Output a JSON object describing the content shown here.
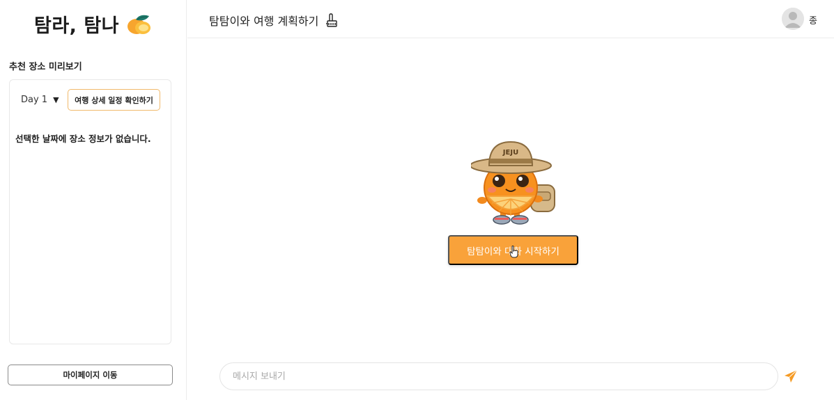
{
  "sidebar": {
    "logo_text": "탐라, 탐나",
    "section_title": "추천 장소 미리보기",
    "day_select": {
      "value": "Day 1"
    },
    "detail_button_label": "여행 상세 일정 확인하기",
    "empty_message": "선택한 날짜에 장소 정보가 없습니다.",
    "mypage_button_label": "마이페이지 이동"
  },
  "header": {
    "title": "탐탐이와 여행 계획하기",
    "user_name": "종"
  },
  "main": {
    "mascot_hat_text": "JEJU",
    "start_button_label": "탐탐이와 대화 시작하기",
    "message_input": {
      "placeholder": "메시지 보내기",
      "value": ""
    }
  },
  "colors": {
    "accent": "#f9a23a",
    "detail_button_border": "#f1b96a",
    "send_icon": "#f59a23"
  },
  "icons": {
    "logo": "tangerine-icon",
    "title": "pencil-icon",
    "avatar": "user-avatar-icon",
    "send": "paper-plane-icon",
    "caret": "caret-down-icon",
    "cursor": "hand-cursor-icon"
  }
}
